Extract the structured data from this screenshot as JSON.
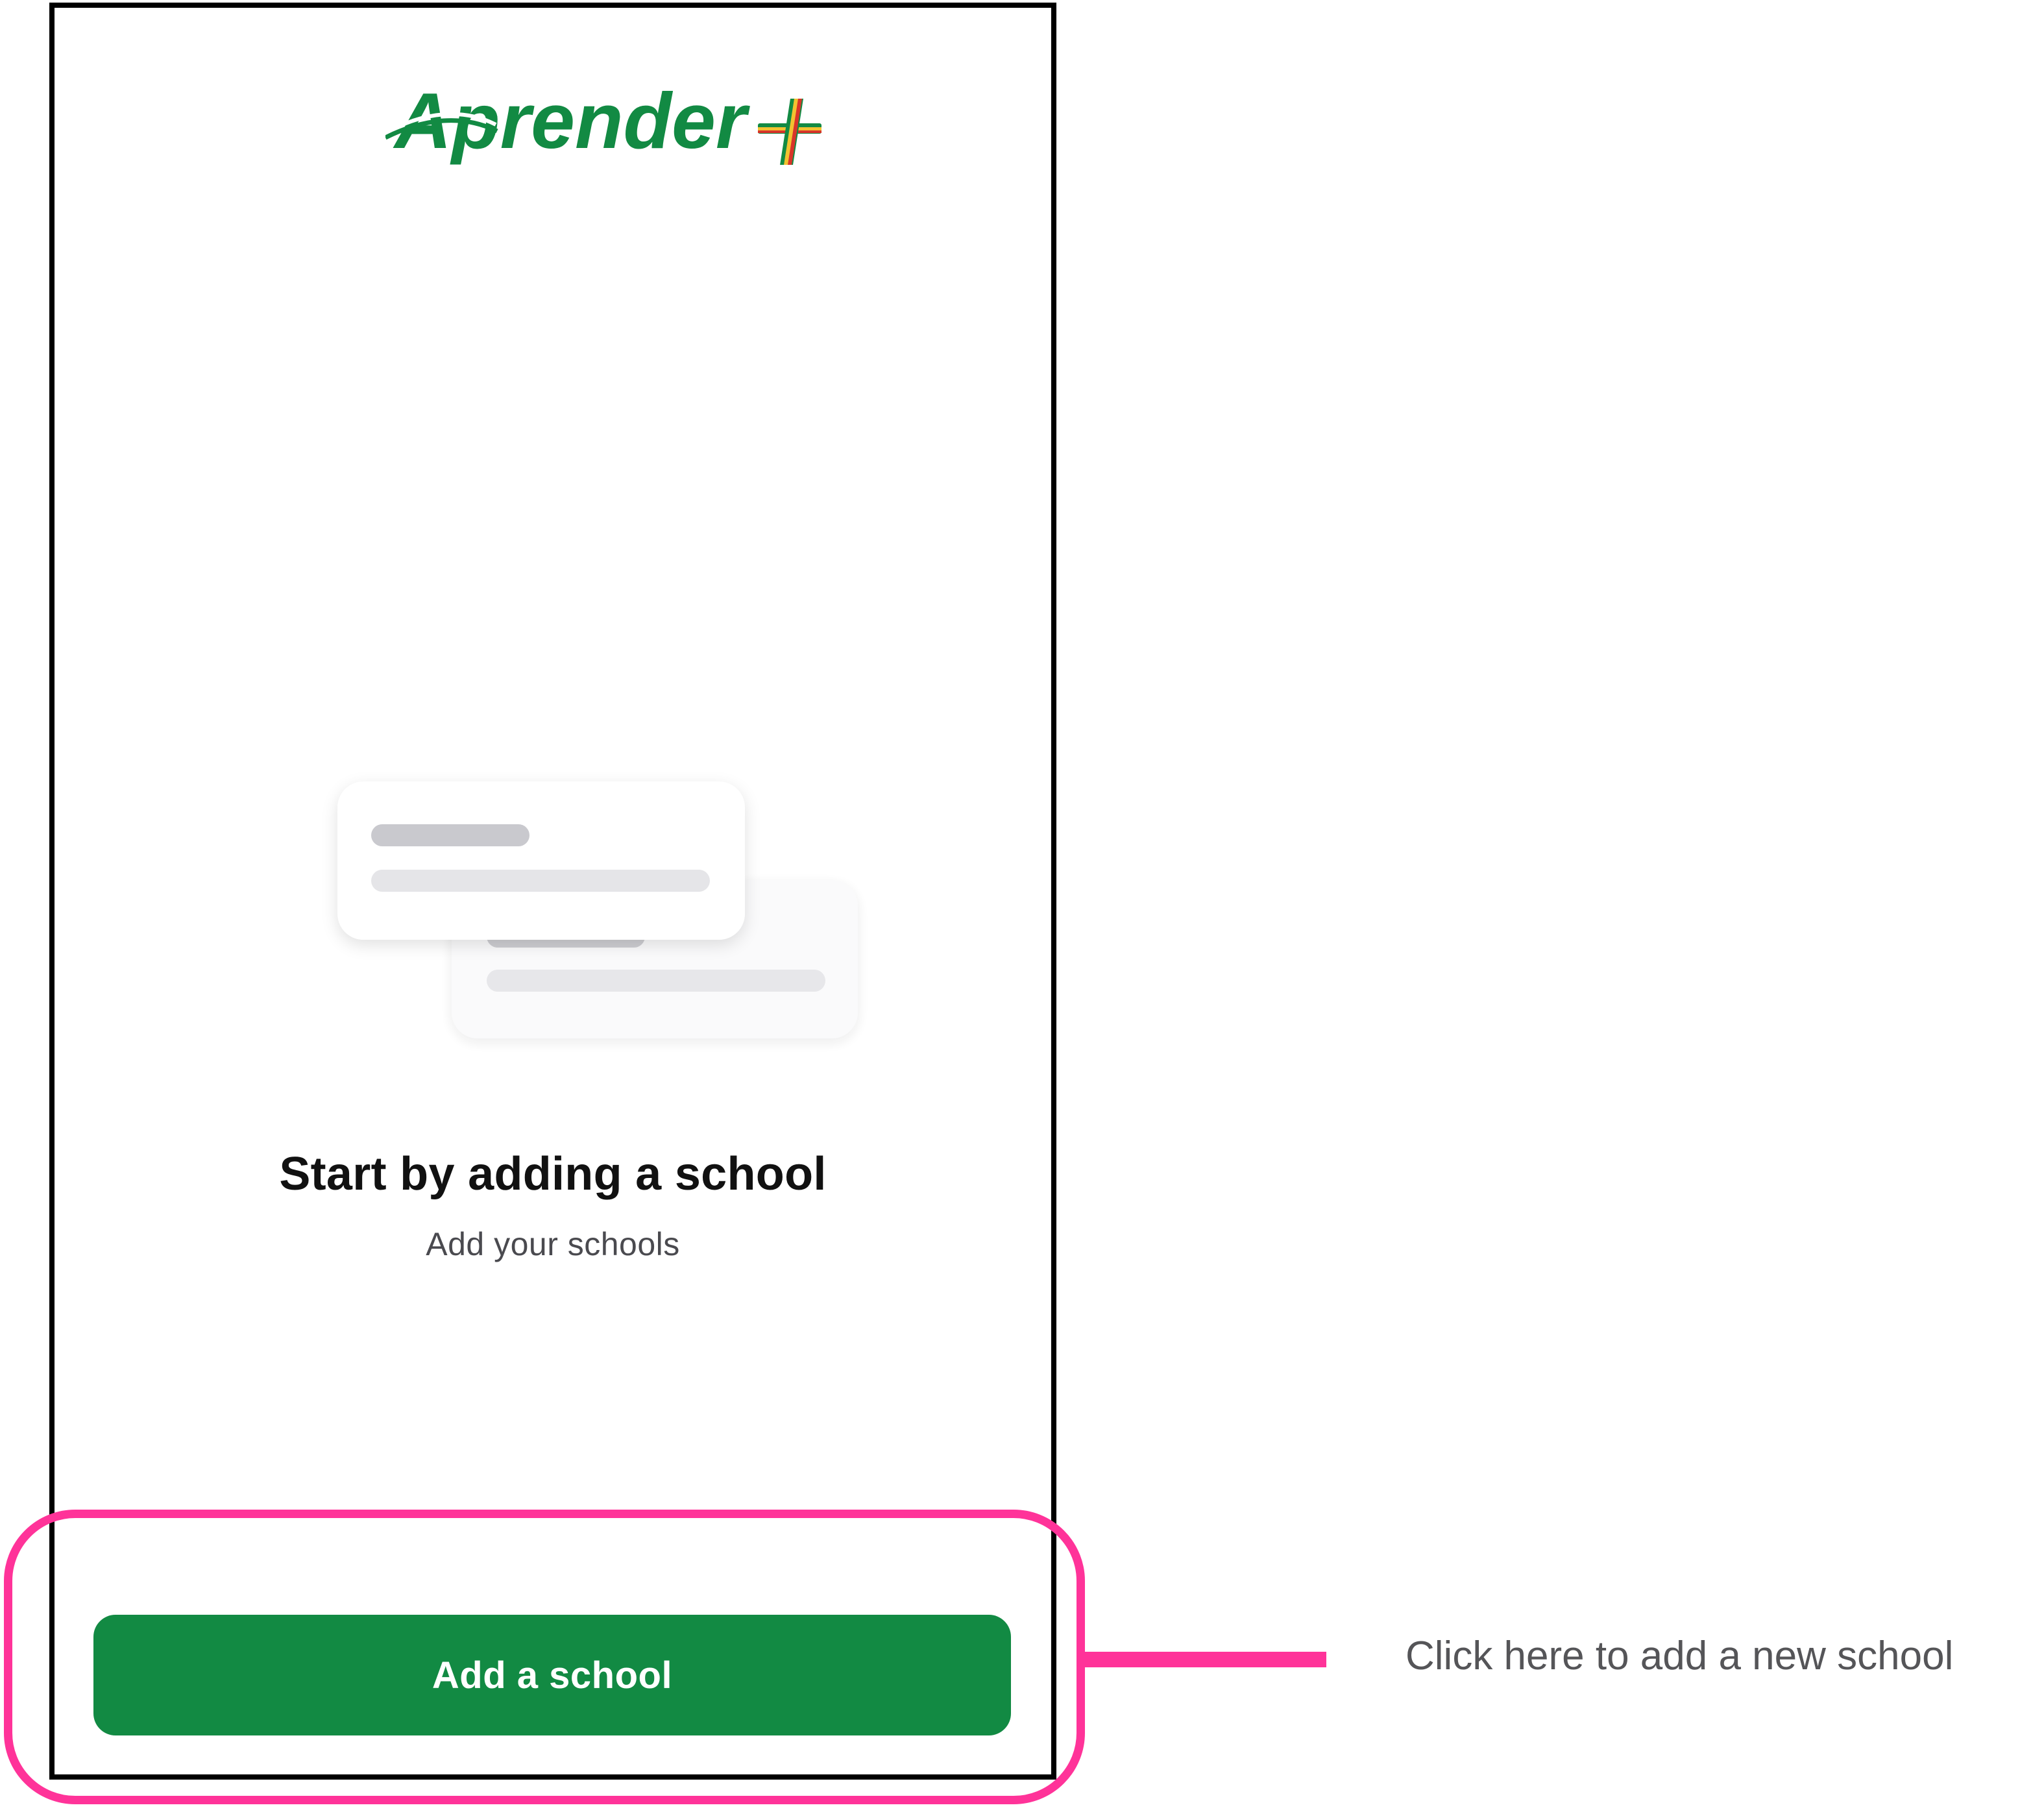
{
  "app": {
    "logo_text": "Aprender",
    "brand_color": "#128a43",
    "plus_colors": [
      "#128a43",
      "#f2c230",
      "#d8352a"
    ]
  },
  "empty_state": {
    "title": "Start by adding a school",
    "subtitle": "Add your schools",
    "illustration_icon": "stacked-cards-placeholder-icon"
  },
  "actions": {
    "add_school_label": "Add a school",
    "button_color": "#128a43"
  },
  "annotation": {
    "text": "Click here to add a new school",
    "highlight_color": "#ff3399"
  }
}
